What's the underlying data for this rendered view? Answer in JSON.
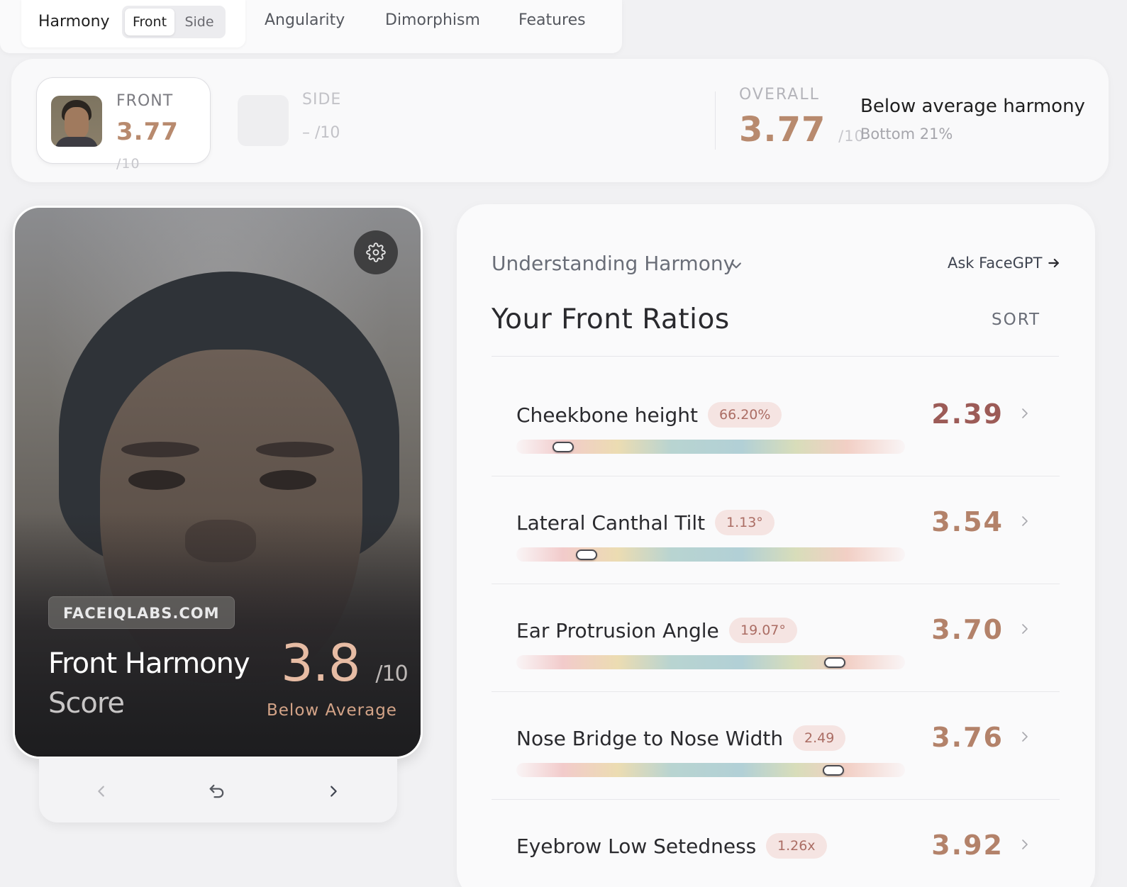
{
  "topnav": {
    "harmony_label": "Harmony",
    "segments": [
      "Front",
      "Side"
    ],
    "active_segment": "Front",
    "tabs": [
      "Angularity",
      "Dimorphism",
      "Features"
    ]
  },
  "scorestrip": {
    "front": {
      "label": "FRONT",
      "score": "3.77",
      "denominator": "/10"
    },
    "side": {
      "label": "SIDE",
      "score": "–",
      "denominator": "/10"
    },
    "overall": {
      "label": "OVERALL",
      "score": "3.77",
      "denominator": "/10"
    },
    "harmony_text": "Below average harmony",
    "harmony_sub": "Bottom 21%"
  },
  "photo_card": {
    "watermark": "FACEIQLABS.COM",
    "title_line1": "Front Harmony",
    "title_line2": "Score",
    "score": "3.8",
    "denominator": "/10",
    "category": "Below Average",
    "icons": [
      "gear-icon",
      "chevron-left-icon",
      "undo-icon",
      "chevron-right-icon"
    ]
  },
  "ratios_panel": {
    "understanding_label": "Understanding Harmony",
    "ask_label": "Ask FaceGPT",
    "title": "Your Front Ratios",
    "sort_label": "SORT",
    "items": [
      {
        "name": "Cheekbone height",
        "badge": "66.20%",
        "score": "2.39",
        "position": 0.12,
        "score_color": "#9c5b57"
      },
      {
        "name": "Lateral Canthal Tilt",
        "badge": "1.13°",
        "score": "3.54",
        "position": 0.18,
        "score_color": "#b3826a"
      },
      {
        "name": "Ear Protrusion Angle",
        "badge": "19.07°",
        "score": "3.70",
        "position": 0.82,
        "score_color": "#b3826a"
      },
      {
        "name": "Nose Bridge to Nose Width",
        "badge": "2.49",
        "score": "3.76",
        "position": 0.816,
        "score_color": "#b3826a"
      },
      {
        "name": "Eyebrow Low Setedness",
        "badge": "1.26x",
        "score": "3.92",
        "position": null,
        "score_color": "#b3826a"
      }
    ]
  },
  "colors": {
    "accent_score": "#b88a6e",
    "badge_bg": "#f5e4e2",
    "badge_text": "#ab6d64"
  }
}
